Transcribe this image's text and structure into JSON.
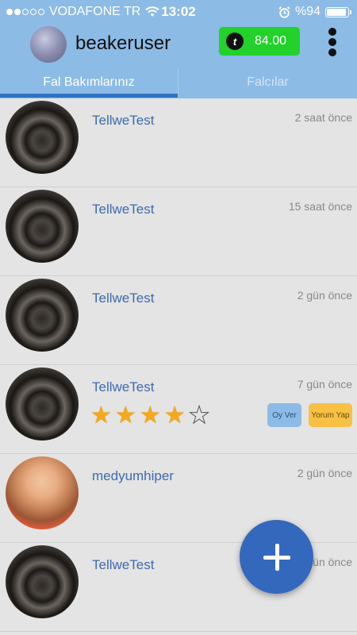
{
  "status_bar": {
    "carrier": "VODAFONE TR",
    "time": "13:02",
    "battery": "%94",
    "battery_level": 0.94,
    "signal_dots": [
      true,
      true,
      false,
      false,
      false
    ]
  },
  "header": {
    "username": "beakeruser",
    "currency_symbol": "t",
    "balance": "84.00",
    "colors": {
      "bar": "#8cbbe5",
      "balance_button": "#22d12a",
      "tab_indicator": "#2f73c2",
      "fab": "#3468bd"
    }
  },
  "tabs": [
    {
      "label": "Fal Bakımlarınız",
      "active": true
    },
    {
      "label": "Falcılar",
      "active": false
    }
  ],
  "items": [
    {
      "name": "TellweTest",
      "time": "2 saat önce"
    },
    {
      "name": "TellweTest",
      "time": "15 saat önce"
    },
    {
      "name": "TellweTest",
      "time": "2 gün önce"
    },
    {
      "name": "TellweTest",
      "time": "7 gün önce",
      "rating": 4,
      "rating_max": 5,
      "vote_label": "Oy Ver",
      "comment_label": "Yorum Yap"
    },
    {
      "name": "medyumhiper",
      "time": "2 gün önce"
    },
    {
      "name": "TellweTest",
      "time": "gün önce"
    }
  ],
  "fab": {
    "icon": "plus-icon"
  }
}
